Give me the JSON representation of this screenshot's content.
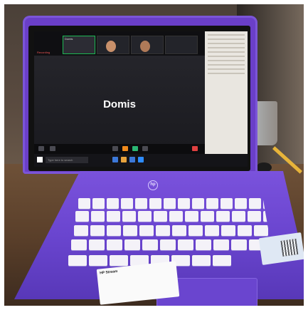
{
  "scene": {
    "device": "purple laptop",
    "brand_logo": "hp",
    "colors": {
      "laptop": "#6a3fc8",
      "screen": "#1d1d22",
      "keys": "#f4f2f8",
      "accent_orange": "#f08a1c"
    }
  },
  "screen": {
    "meeting_participant_name": "Domis",
    "top_tile_label": "Domis",
    "recording_label": "Recording",
    "taskbar_search_placeholder": "Type here to search"
  },
  "stickers": {
    "left_label": "HP Stream",
    "right_label": ""
  }
}
